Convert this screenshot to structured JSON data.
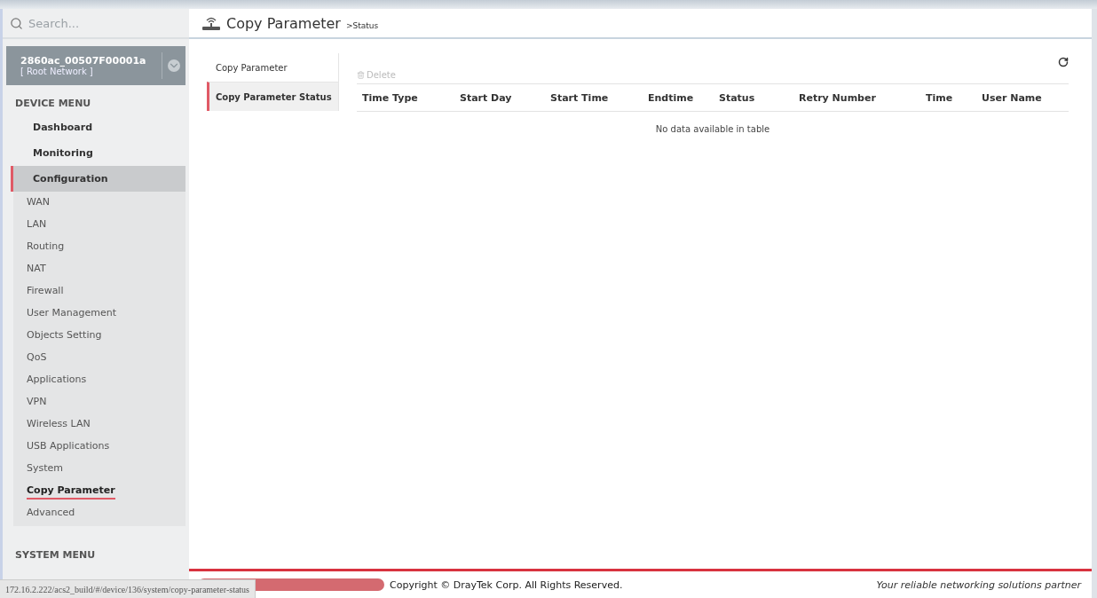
{
  "sidebar": {
    "search": {
      "placeholder": "Search..."
    },
    "device": {
      "name": "2860ac_00507F00001a",
      "network": "[ Root Network ]"
    },
    "device_menu": {
      "title": "DEVICE MENU",
      "items": [
        {
          "label": "Dashboard",
          "selected": false
        },
        {
          "label": "Monitoring",
          "selected": false
        },
        {
          "label": "Configuration",
          "selected": true,
          "children": [
            {
              "label": "WAN",
              "selected": false
            },
            {
              "label": "LAN",
              "selected": false
            },
            {
              "label": "Routing",
              "selected": false
            },
            {
              "label": "NAT",
              "selected": false
            },
            {
              "label": "Firewall",
              "selected": false
            },
            {
              "label": "User Management",
              "selected": false
            },
            {
              "label": "Objects Setting",
              "selected": false
            },
            {
              "label": "QoS",
              "selected": false
            },
            {
              "label": "Applications",
              "selected": false
            },
            {
              "label": "VPN",
              "selected": false
            },
            {
              "label": "Wireless LAN",
              "selected": false
            },
            {
              "label": "USB Applications",
              "selected": false
            },
            {
              "label": "System",
              "selected": false
            },
            {
              "label": "Copy Parameter",
              "selected": true
            },
            {
              "label": "Advanced",
              "selected": false
            }
          ]
        }
      ]
    },
    "system_menu": {
      "title": "SYSTEM MENU"
    }
  },
  "page": {
    "title": "Copy Parameter",
    "subtitle": ">Status"
  },
  "tabs": [
    {
      "label": "Copy Parameter",
      "selected": false
    },
    {
      "label": "Copy Parameter Status",
      "selected": true
    }
  ],
  "toolbar": {
    "delete": {
      "label": "Delete",
      "disabled": true
    }
  },
  "table": {
    "columns": [
      "Time Type",
      "Start Day",
      "Start Time",
      "Endtime",
      "Status",
      "Retry Number",
      "Time",
      "User Name"
    ],
    "empty": "No data available in table"
  },
  "footer": {
    "copyright": "Copyright © DrayTek Corp. All Rights Reserved.",
    "tagline": "Your reliable networking solutions partner"
  },
  "status_url": "172.16.2.222/acs2_build/#/device/136/system/copy-parameter-status"
}
